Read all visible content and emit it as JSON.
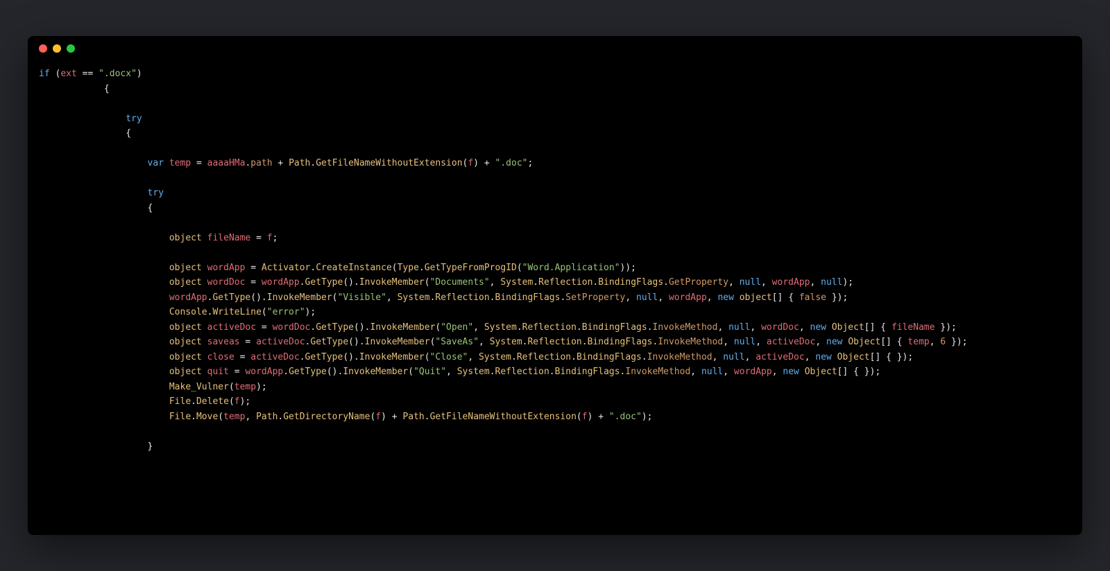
{
  "window": {
    "traffic_lights": [
      "red",
      "yellow",
      "green"
    ]
  },
  "tokens": {
    "kw_if": "if",
    "kw_try": "try",
    "kw_var": "var",
    "kw_new": "new",
    "kw_null": "null",
    "kw_false": "false"
  },
  "identifiers": {
    "ext": "ext",
    "temp": "temp",
    "aaaaHMa": "aaaaHMa",
    "path": "path",
    "Path": "Path",
    "GetFileNameWithoutExtension": "GetFileNameWithoutExtension",
    "GetDirectoryName": "GetDirectoryName",
    "f": "f",
    "object": "object",
    "Object": "Object",
    "fileName": "fileName",
    "wordApp": "wordApp",
    "wordDoc": "wordDoc",
    "activeDoc": "activeDoc",
    "saveas": "saveas",
    "close": "close",
    "quit": "quit",
    "Activator": "Activator",
    "CreateInstance": "CreateInstance",
    "Type": "Type",
    "GetTypeFromProgID": "GetTypeFromProgID",
    "GetType": "GetType",
    "InvokeMember": "InvokeMember",
    "System": "System",
    "Reflection": "Reflection",
    "BindingFlags": "BindingFlags",
    "GetProperty": "GetProperty",
    "SetProperty": "SetProperty",
    "InvokeMethod": "InvokeMethod",
    "Console": "Console",
    "WriteLine": "WriteLine",
    "Make_Vulner": "Make_Vulner",
    "File": "File",
    "Delete": "Delete",
    "Move": "Move"
  },
  "strings": {
    "docx": "\".docx\"",
    "doc": "\".doc\"",
    "wordApplication": "\"Word.Application\"",
    "documents": "\"Documents\"",
    "visible": "\"Visible\"",
    "error": "\"error\"",
    "open": "\"Open\"",
    "saveas": "\"SaveAs\"",
    "close": "\"Close\"",
    "quit": "\"Quit\""
  },
  "numbers": {
    "six": "6"
  }
}
